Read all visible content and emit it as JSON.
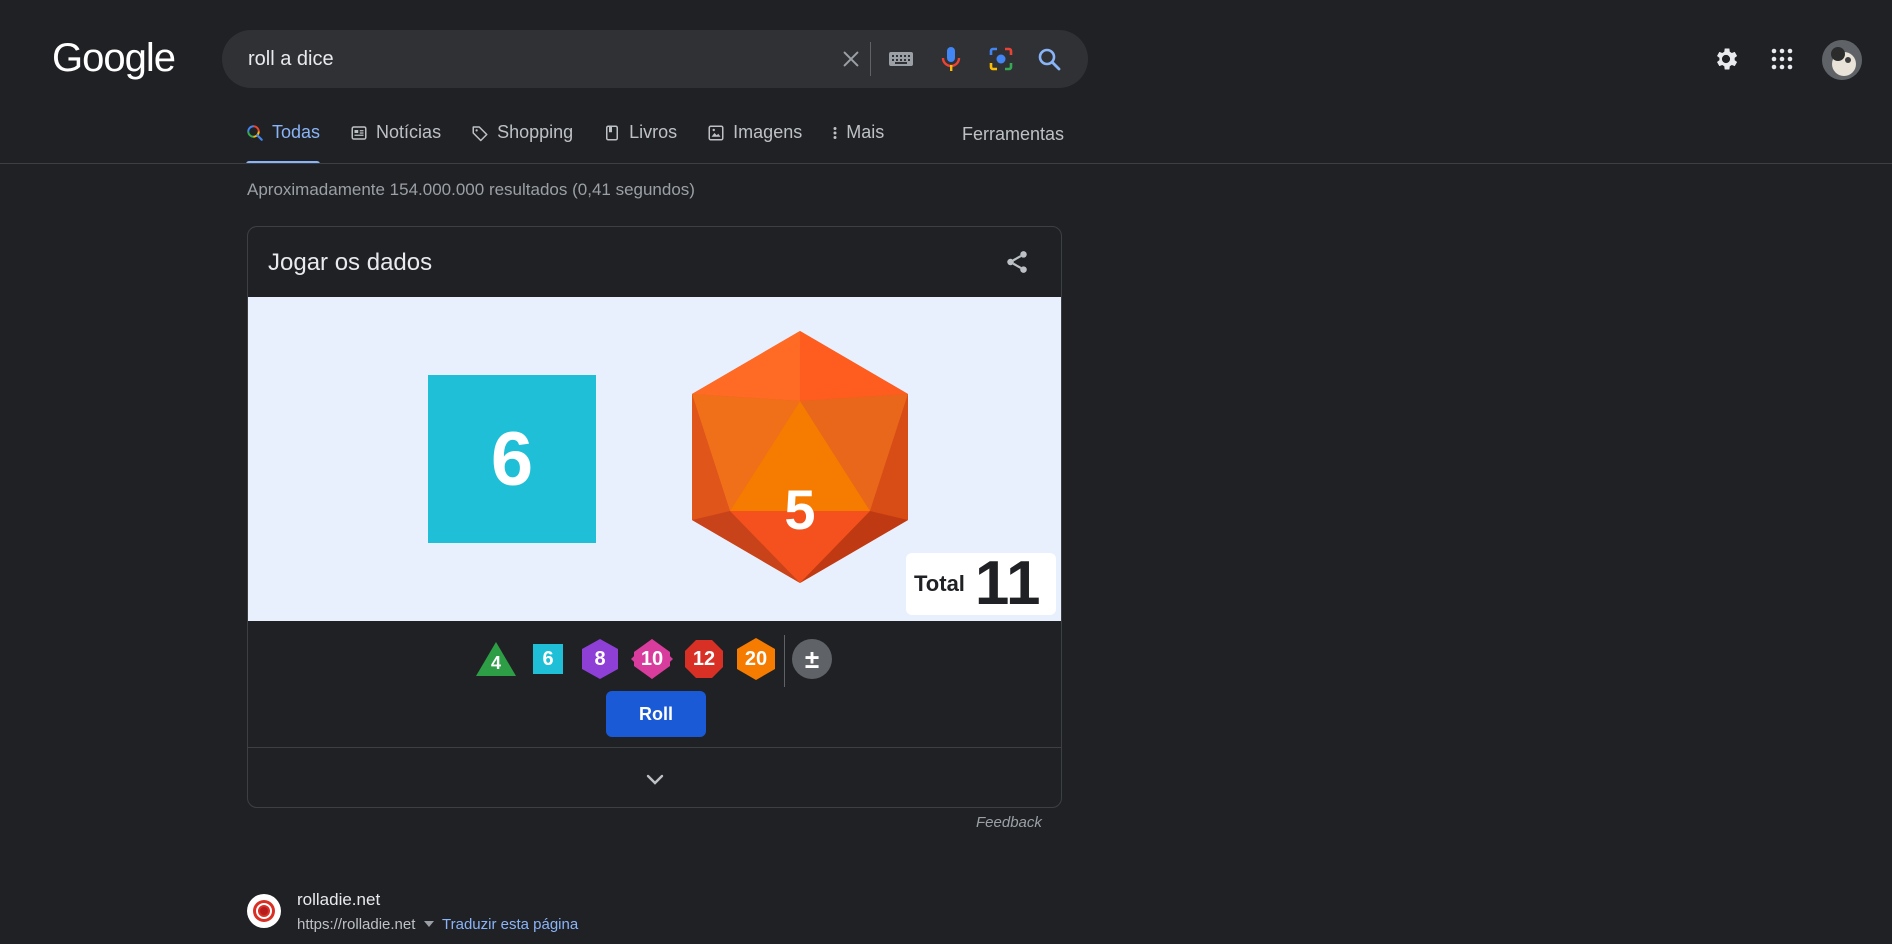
{
  "logo": "Google",
  "search": {
    "query": "roll a dice"
  },
  "tabs": [
    {
      "label": "Todas",
      "active": true
    },
    {
      "label": "Notícias"
    },
    {
      "label": "Shopping"
    },
    {
      "label": "Livros"
    },
    {
      "label": "Imagens"
    },
    {
      "label": "Mais"
    }
  ],
  "tools_label": "Ferramentas",
  "result_stats": "Aproximadamente 154.000.000 resultados (0,41 segundos)",
  "dice_card": {
    "title": "Jogar os dados",
    "square_die_value": "6",
    "d20_value": "5",
    "total_label": "Total",
    "total_value": "11",
    "dice_buttons": [
      "4",
      "6",
      "8",
      "10",
      "12",
      "20",
      "±"
    ],
    "roll_label": "Roll",
    "colors": {
      "d6": "#1fc0d7",
      "d20": "#f4511e",
      "d4": "#2e9e46",
      "d8": "#8e3fd6",
      "d10": "#d83d9d",
      "d12": "#d93025",
      "roll": "#1a5ad7"
    }
  },
  "feedback": "Feedback",
  "result": {
    "site_name": "rolladie.net",
    "url": "https://rolladie.net",
    "translate": "Traduzir esta página"
  }
}
